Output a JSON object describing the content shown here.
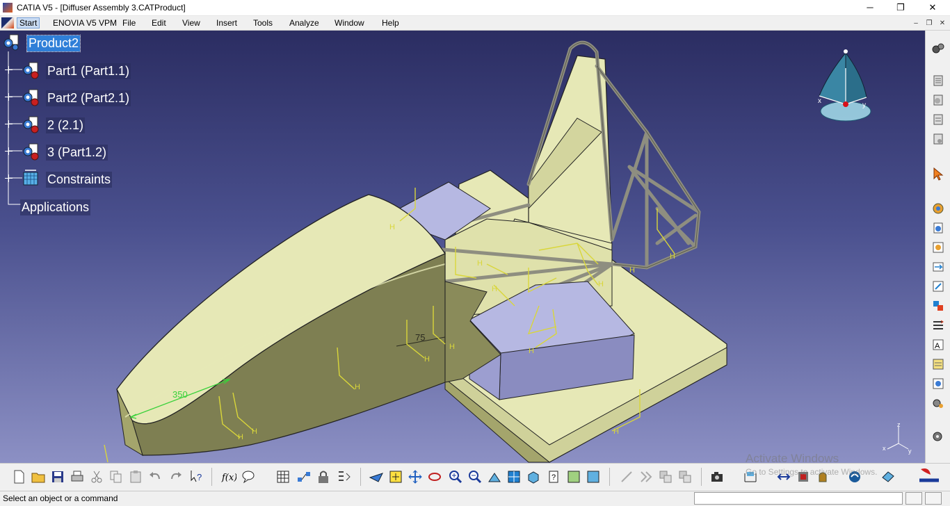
{
  "window": {
    "title": "CATIA V5 - [Diffuser Assembly 3.CATProduct]",
    "minimize": "─",
    "maximize": "❐",
    "close": "✕"
  },
  "menu": {
    "items": [
      "Start",
      "ENOVIA V5 VPM",
      "File",
      "Edit",
      "View",
      "Insert",
      "Tools",
      "Analyze",
      "Window",
      "Help"
    ],
    "doc_minimize": "‒",
    "doc_restore": "❐",
    "doc_close": "✕"
  },
  "tree": {
    "root": "Product2",
    "nodes": [
      {
        "label": "Part1 (Part1.1)",
        "icon": "part-icon"
      },
      {
        "label": "Part2 (Part2.1)",
        "icon": "part-icon"
      },
      {
        "label": "2 (2.1)",
        "icon": "part-icon"
      },
      {
        "label": "3 (Part1.2)",
        "icon": "part-icon"
      },
      {
        "label": "Constraints",
        "icon": "constraints-icon"
      }
    ],
    "applications": "Applications"
  },
  "model": {
    "dimension_350": "350",
    "dimension_75": "75",
    "constraint_letter": "H",
    "colors": {
      "body": "#e6e8b6",
      "body_shadow": "#a4a56c",
      "body_dark": "#7e7f52",
      "lavender": "#b6b8e2",
      "lavender_dark": "#8a8cc0",
      "tube": "#a8a89a",
      "constraint": "#d9d63a",
      "dimension": "#39d13a"
    }
  },
  "compass": {
    "x_label": "x",
    "y_label": "y",
    "z_label": "z"
  },
  "right_toolbar": {
    "icons": [
      "gears-icon",
      "product-structure-icon",
      "new-component-icon",
      "new-product-icon",
      "new-part-icon",
      "select-arrow-icon",
      "existing-component-icon",
      "replace-component-icon",
      "graph-tree-icon",
      "generate-numbering-icon",
      "manage-representations-icon",
      "multi-instantiation-icon",
      "fast-multi-instantiation-icon",
      "reorder-icon",
      "bill-of-material-icon",
      "scenes-icon"
    ]
  },
  "bottom_toolbar": {
    "icons": [
      "new-icon",
      "open-icon",
      "save-icon",
      "print-icon",
      "cut-icon",
      "copy-icon",
      "paste-icon",
      "undo-icon",
      "redo-icon",
      "whats-this-icon",
      "formula-icon",
      "comment-icon",
      "catalog-icon",
      "product-knowledge-icon",
      "lock-icon",
      "rules-icon",
      "fly-mode-icon",
      "fit-all-icon",
      "pan-icon",
      "rotate-icon",
      "zoom-in-icon",
      "zoom-out-icon",
      "normal-view-icon",
      "multi-view-icon",
      "isometric-view-icon",
      "quick-view-icon",
      "hide-show-icon",
      "swap-visible-icon",
      "properties-icon",
      "manipulate-icon",
      "snap-icon",
      "explode-icon",
      "camera-icon",
      "measure-icon",
      "clash-icon",
      "fix-icon",
      "material-icon",
      "update-icon",
      "render-icon"
    ]
  },
  "watermark": {
    "line1": "Activate Windows",
    "line2": "Go to Settings to activate Windows."
  },
  "status": {
    "message": "Select an object or a command",
    "command_value": ""
  }
}
